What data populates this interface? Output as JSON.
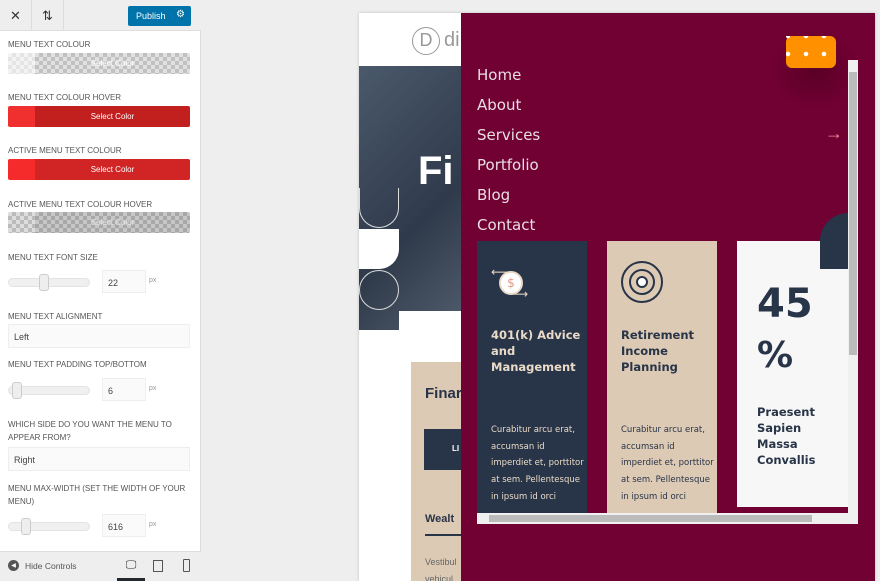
{
  "toolbar": {
    "close_icon": "close-icon",
    "reorder_icon": "sort-arrows-icon",
    "publish_label": "Publish",
    "gear_icon": "gear-icon"
  },
  "settings": {
    "menu_text_colour": {
      "label": "MENU TEXT COLOUR",
      "button": "Select Color",
      "color": "transparent"
    },
    "menu_text_colour_hover": {
      "label": "MENU TEXT COLOUR HOVER",
      "button": "Select Color",
      "color": "#c21f1f"
    },
    "active_menu_text_colour": {
      "label": "ACTIVE MENU TEXT COLOUR",
      "button": "Select Color",
      "color": "#d12424"
    },
    "active_menu_text_colour_hover": {
      "label": "ACTIVE MENU TEXT COLOUR HOVER",
      "button": "Select Color",
      "color": "transparent"
    },
    "font_size": {
      "label": "MENU TEXT FONT SIZE",
      "value": "22",
      "unit": "px"
    },
    "alignment": {
      "label": "MENU TEXT ALIGNMENT",
      "value": "Left"
    },
    "padding": {
      "label": "MENU TEXT PADDING TOP/BOTTOM",
      "value": "6",
      "unit": "px"
    },
    "side": {
      "label": "WHICH SIDE DO YOU WANT THE MENU TO APPEAR FROM?",
      "value": "Right"
    },
    "max_width": {
      "label": "MENU MAX-WIDTH (SET THE WIDTH OF YOUR MENU)",
      "value": "616",
      "unit": "px"
    }
  },
  "footer": {
    "hide_controls": "Hide Controls",
    "devices": [
      "desktop",
      "tablet",
      "mobile"
    ],
    "active_device": "desktop"
  },
  "preview": {
    "logo_letter": "D",
    "logo_text": "di",
    "hero_text": "Fi",
    "box_title": "Finar",
    "box_button": "LI",
    "box_subtitle": "Wealt",
    "box_text1": "Vestibul",
    "box_text2": "vehicul",
    "overlay_color": "#710033",
    "menu": [
      "Home",
      "About",
      "Services",
      "Portfolio",
      "Blog",
      "Contact"
    ],
    "services_arrow": "→",
    "cards": [
      {
        "title": "401(k) Advice and Management",
        "text": "Curabitur arcu erat, accumsan id imperdiet et, porttitor at sem. Pellentesque in ipsum id orci",
        "icon": "dollar-exchange-icon",
        "bg": "#283447"
      },
      {
        "title": "Retirement Income Planning",
        "text": "Curabitur arcu erat, accumsan id imperdiet et, porttitor at sem. Pellentesque in ipsum id orci",
        "icon": "target-icon",
        "bg": "#dccab5"
      },
      {
        "stat_number": "45",
        "stat_unit": "%",
        "title": "Praesent Sapien Massa Convallis",
        "bg": "#f7f7f7"
      }
    ],
    "toggle_color": "#ff9100"
  }
}
